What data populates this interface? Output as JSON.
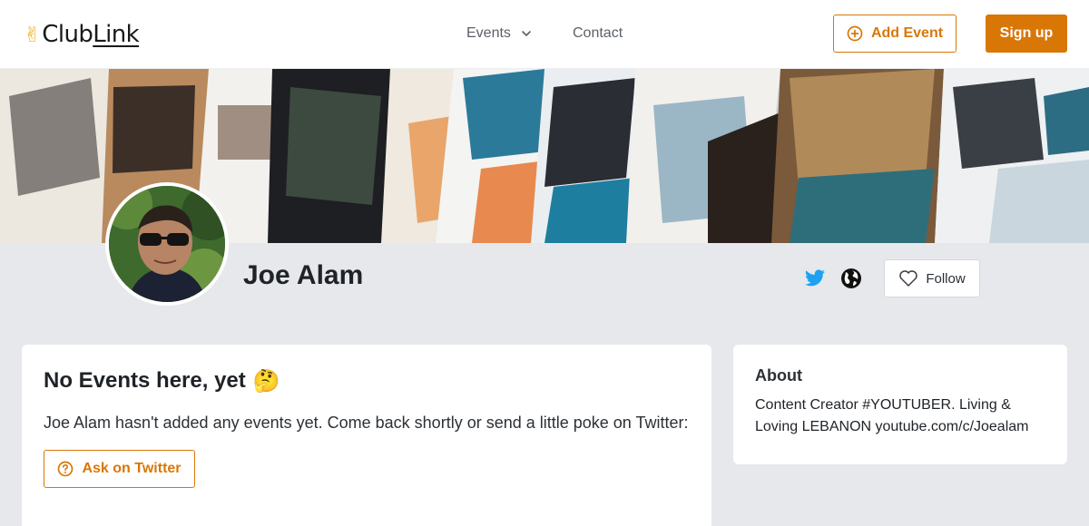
{
  "header": {
    "logo_word1": "Club",
    "logo_word2": "Link",
    "nav_events": "Events",
    "nav_contact": "Contact",
    "add_event": "Add Event",
    "sign_up": "Sign up"
  },
  "profile": {
    "name": "Joe Alam",
    "follow": "Follow"
  },
  "events": {
    "title": "No Events here, yet",
    "title_emoji": "🤔",
    "description": "Joe Alam hasn't added any events yet. Come back shortly or send a little poke on Twitter:",
    "ask_button": "Ask on Twitter"
  },
  "about": {
    "title": "About",
    "text": "Content Creator #YOUTUBER. Living & Loving LEBANON youtube.com/c/Joealam"
  },
  "icons": {
    "logo": "victory-hand-icon",
    "events_dropdown": "chevron-down-icon",
    "add_event": "plus-circle-icon",
    "twitter": "twitter-icon",
    "website": "globe-icon",
    "follow": "heart-icon",
    "ask": "question-circle-icon"
  },
  "colors": {
    "accent": "#d97706",
    "twitter": "#1da1f2",
    "page_background": "#e6e8ec"
  }
}
